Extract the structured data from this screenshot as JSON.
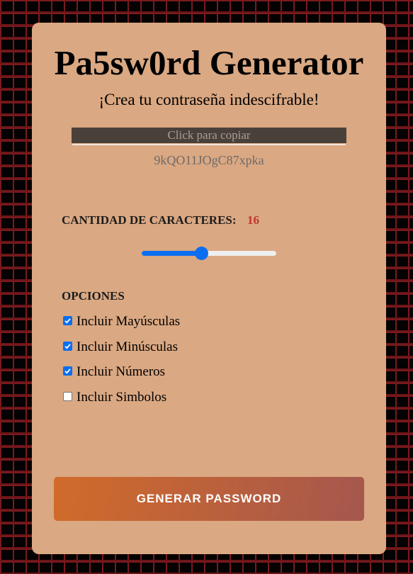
{
  "app": {
    "title": "Pa5sw0rd Generator",
    "subtitle": "¡Crea tu contraseña indescifrable!"
  },
  "output": {
    "copy_label": "Click para copiar",
    "password": "9kQO11JOgC87xpka"
  },
  "length": {
    "label": "CANTIDAD DE CARACTERES:",
    "value": "16",
    "slider_fraction": 0.44
  },
  "options": {
    "label": "OPCIONES",
    "items": [
      {
        "label": "Incluir Mayúsculas",
        "checked": true
      },
      {
        "label": "Incluir Minúsculas",
        "checked": true
      },
      {
        "label": "Incluir Números",
        "checked": true
      },
      {
        "label": "Incluir Simbolos",
        "checked": false
      }
    ]
  },
  "actions": {
    "generate_label": "GENERAR PASSWORD"
  },
  "colors": {
    "card": "#daa882",
    "accent": "#0b6ef0",
    "length_value": "#c3342b",
    "button_start": "#d16b2a",
    "button_end": "#a5574e"
  }
}
